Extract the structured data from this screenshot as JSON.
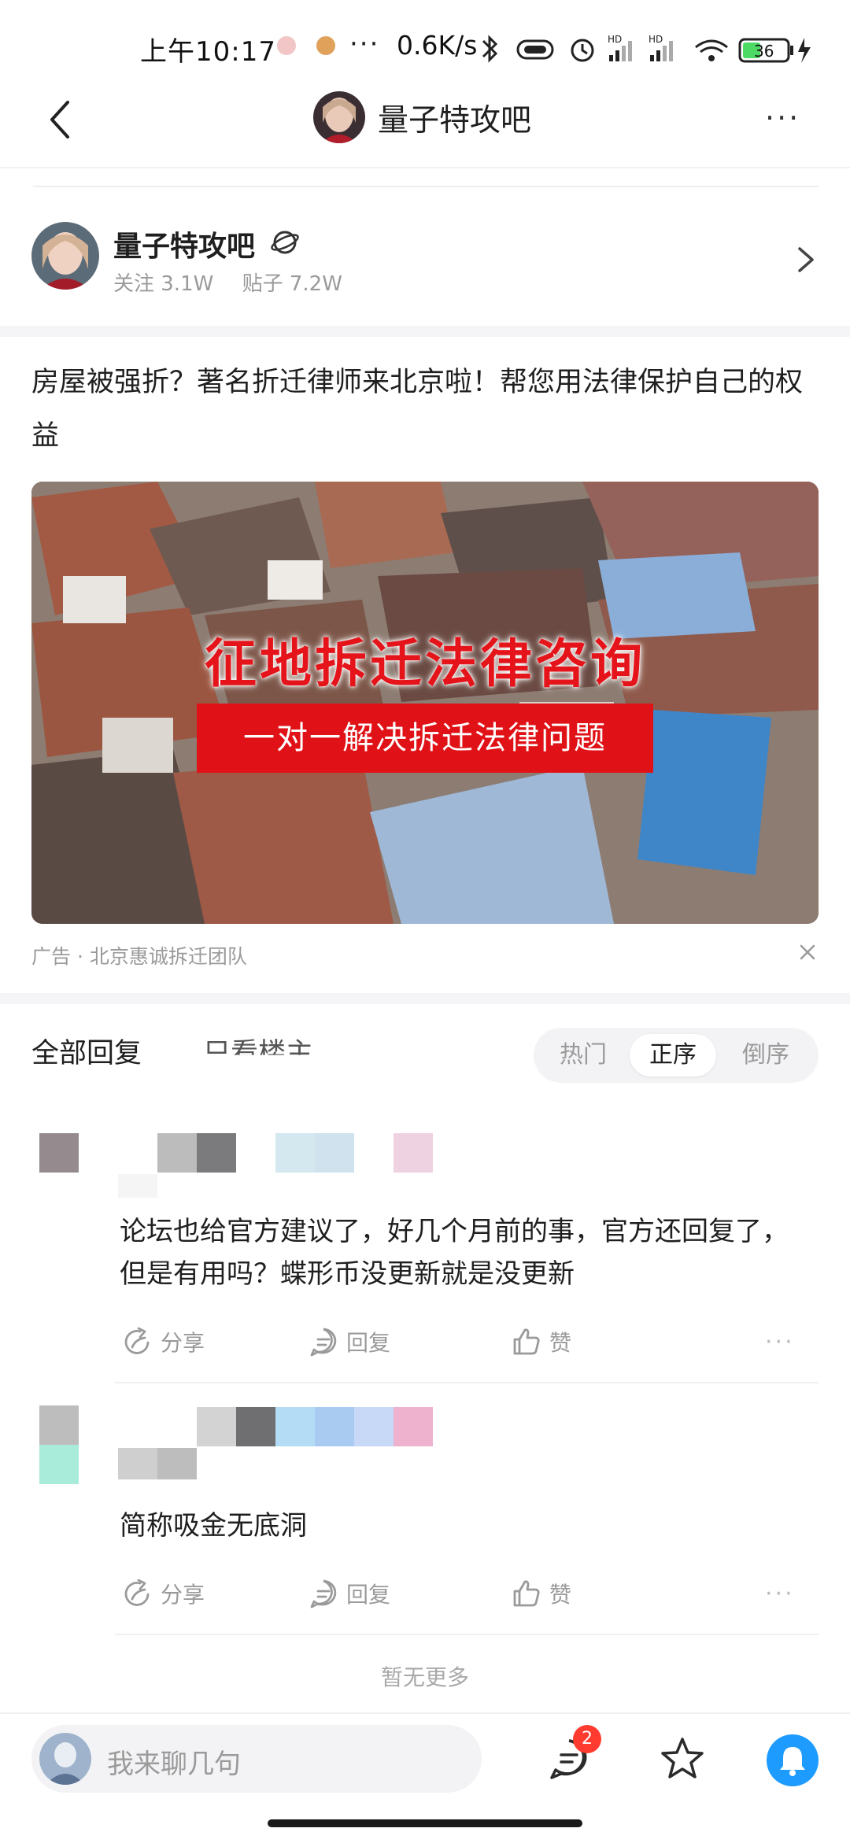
{
  "status_bar": {
    "time": "上午10:17",
    "dots": "···",
    "net_speed": "0.6K/s",
    "battery": "36"
  },
  "nav": {
    "title": "量子特攻吧",
    "more": "···"
  },
  "forum": {
    "name": "量子特攻吧",
    "follow_label": "关注 3.1W",
    "posts_label": "贴子 7.2W"
  },
  "ad": {
    "title": "房屋被强折？著名折迁律师来北京啦！帮您用法律保护自己的权益",
    "image_headline": "征地拆迁法律咨询",
    "image_banner": "一对一解决拆迁法律问题",
    "source": "广告 · 北京惠诚拆迁团队"
  },
  "tabs": {
    "all": "全部回复",
    "owner_only": "只看楼主",
    "sort": [
      "热门",
      "正序",
      "倒序"
    ],
    "sort_active": "正序"
  },
  "replies": [
    {
      "text": "论坛也给官方建议了，好几个月前的事，官方还回复了，但是有用吗？蝶形币没更新就是没更新",
      "actions": {
        "share": "分享",
        "reply": "回复",
        "like": "赞"
      }
    },
    {
      "text": "简称吸金无底洞",
      "actions": {
        "share": "分享",
        "reply": "回复",
        "like": "赞"
      }
    }
  ],
  "no_more": "暂无更多",
  "bottom": {
    "placeholder": "我来聊几句",
    "badge_count": "2"
  },
  "colors": {
    "accent": "#1e9bff",
    "badge": "#ff3b30",
    "ad_red": "#e01217",
    "battery_green": "#4cd964"
  },
  "icons": [
    "back-arrow-icon",
    "more-icon",
    "forum-badge-icon",
    "chevron-right-icon",
    "close-icon",
    "share-icon",
    "reply-icon",
    "like-icon",
    "comment-icon",
    "star-icon",
    "bell-icon"
  ]
}
